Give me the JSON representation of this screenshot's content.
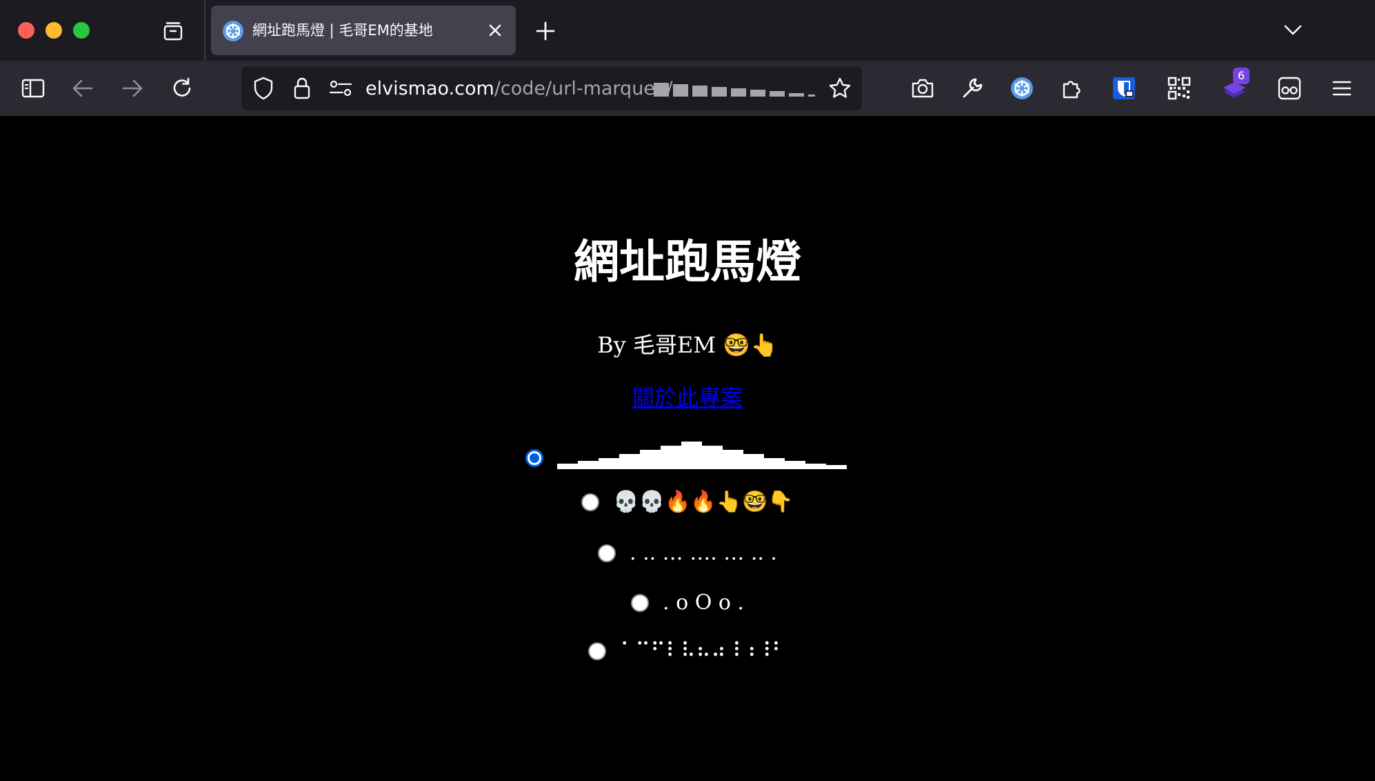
{
  "browser": {
    "tab": {
      "title": "網址跑馬燈 | 毛哥EM的基地",
      "close_label": "✕"
    },
    "new_tab_label": "+",
    "url": {
      "host": "elvismao.com",
      "path": "/code/url-marquee/"
    },
    "extensions": {
      "notification_count": "6"
    }
  },
  "page": {
    "title": "網址跑馬燈",
    "byline": "By 毛哥EM 🤓👆",
    "about_link": "關於此專案",
    "options": [
      {
        "label": "",
        "checked": true,
        "icon": "bar-wave"
      },
      {
        "label": "💀💀🔥🔥👆🤓👇",
        "checked": false
      },
      {
        "label": ". .. … …. … .. .",
        "checked": false
      },
      {
        "label": ". o O o .",
        "checked": false
      },
      {
        "label": "⠁⠉⠋⠇⠧⠦⠴⠸⠰⠸⠃",
        "checked": false
      }
    ]
  },
  "colors": {
    "tabstrip_bg": "#1c1b22",
    "navbar_bg": "#2b2a33",
    "page_bg": "#000000",
    "link": "#0000ee",
    "radio_checked": "#0060df"
  }
}
